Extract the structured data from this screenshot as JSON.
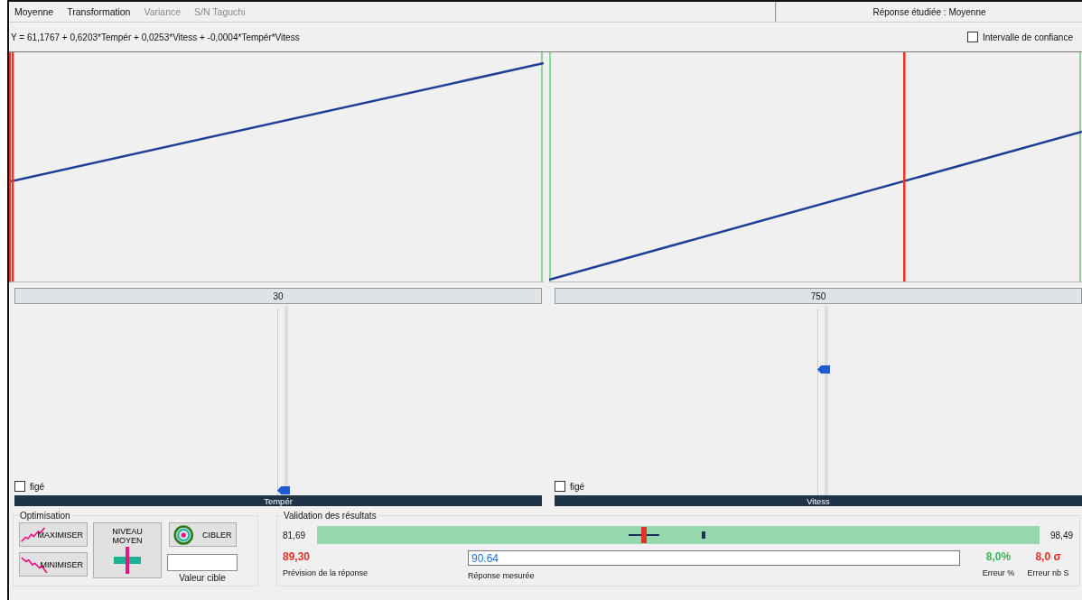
{
  "menu": [
    {
      "label": "Moyenne",
      "disabled": false
    },
    {
      "label": "Transformation",
      "disabled": false
    },
    {
      "label": "Variance",
      "disabled": true
    },
    {
      "label": "S/N Taguchi",
      "disabled": true
    }
  ],
  "response_label": "Réponse étudiée : Moyenne",
  "equation": "Y = 61,1767 + 0,6203*Tempér + 0,0253*Vitess + -0,0004*Tempér*Vitess",
  "confidence_interval": {
    "label": "Intervalle de confiance",
    "checked": false
  },
  "factors": [
    {
      "name": "Tempér",
      "value": "30",
      "level": 0,
      "frozen_label": "figé",
      "frozen": false
    },
    {
      "name": "Vitess",
      "value": "750",
      "level": 0.67,
      "frozen_label": "figé",
      "frozen": false
    }
  ],
  "optimisation": {
    "title": "Optimisation",
    "maximise": "MAXIMISER",
    "minimise": "MINIMISER",
    "average": "NIVEAU MOYEN",
    "target": "CIBLER",
    "target_label": "Valeur cible"
  },
  "validation": {
    "title": "Validation des résultats",
    "min": "81,69",
    "max": "98,49",
    "prediction": {
      "value": "89,30",
      "label": "Prévision de la réponse",
      "level": 0.453
    },
    "measured": {
      "value": "90.64",
      "label": "Réponse mesurée",
      "level": 0.533
    },
    "error_pct": {
      "value": "8,0%",
      "label": "Erreur %"
    },
    "error_sigma": {
      "value": "8,0 σ",
      "label": "Erreur nb S"
    }
  }
}
